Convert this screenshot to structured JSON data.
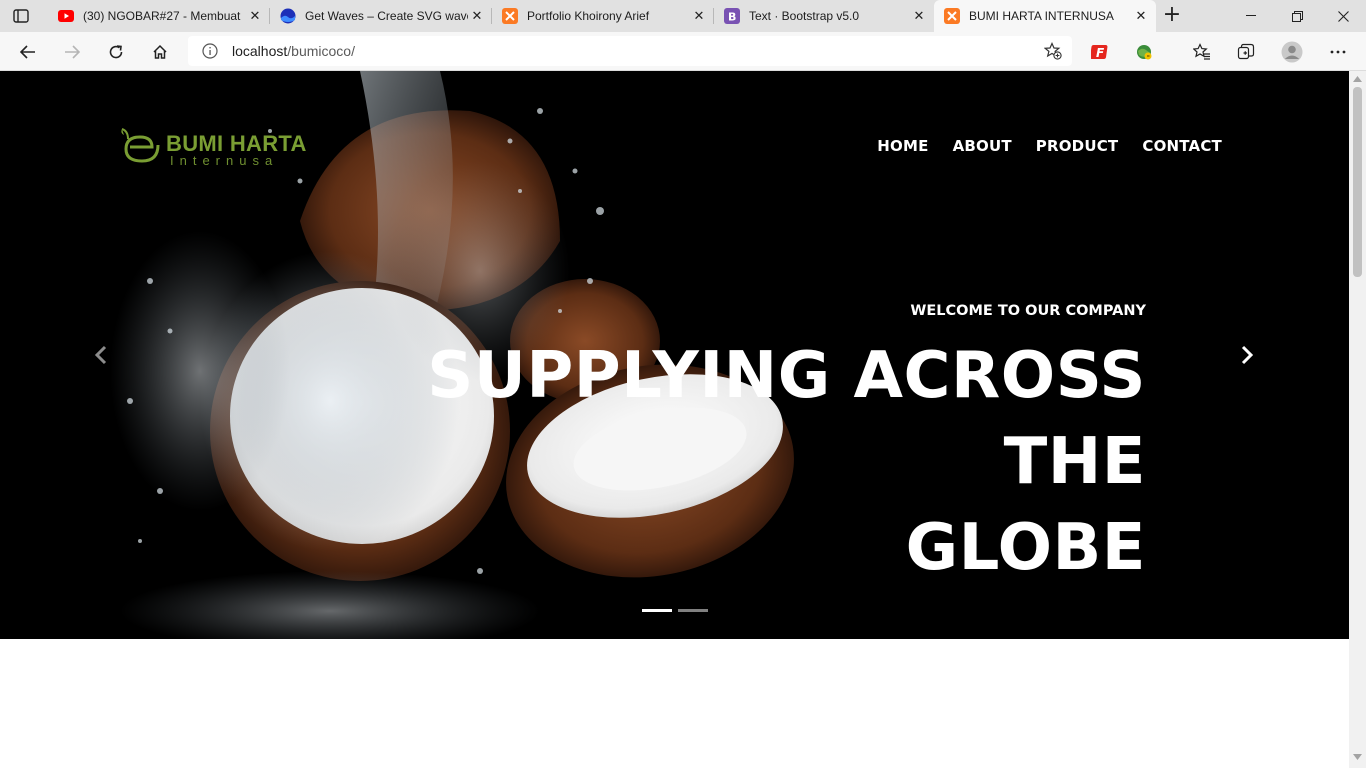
{
  "browser": {
    "tabs": [
      {
        "title": "(30) NGOBAR#27 - Membuat",
        "icon": "youtube-icon"
      },
      {
        "title": "Get Waves – Create SVG wave",
        "icon": "getwaves-icon"
      },
      {
        "title": "Portfolio Khoirony Arief",
        "icon": "xampp-icon"
      },
      {
        "title": "Text · Bootstrap v5.0",
        "icon": "bootstrap-icon"
      },
      {
        "title": "BUMI HARTA INTERNUSA",
        "icon": "xampp-icon",
        "active": true
      }
    ],
    "address": {
      "host": "localhost",
      "path": "/bumicoco/"
    }
  },
  "site": {
    "logo": {
      "name": "BUMI HARTA",
      "sub": "Internusa"
    },
    "nav": [
      "HOME",
      "ABOUT",
      "PRODUCT",
      "CONTACT"
    ],
    "hero": {
      "eyebrow": "WELCOME TO OUR COMPANY",
      "headline_line1": "SUPPLYING ACROSS THE",
      "headline_line2": "GLOBE",
      "slides": 2,
      "active_slide": 1
    }
  },
  "colors": {
    "brand_green": "#7a9e33",
    "tab_active": "#f7f7f7",
    "hero_bg": "#000000"
  }
}
